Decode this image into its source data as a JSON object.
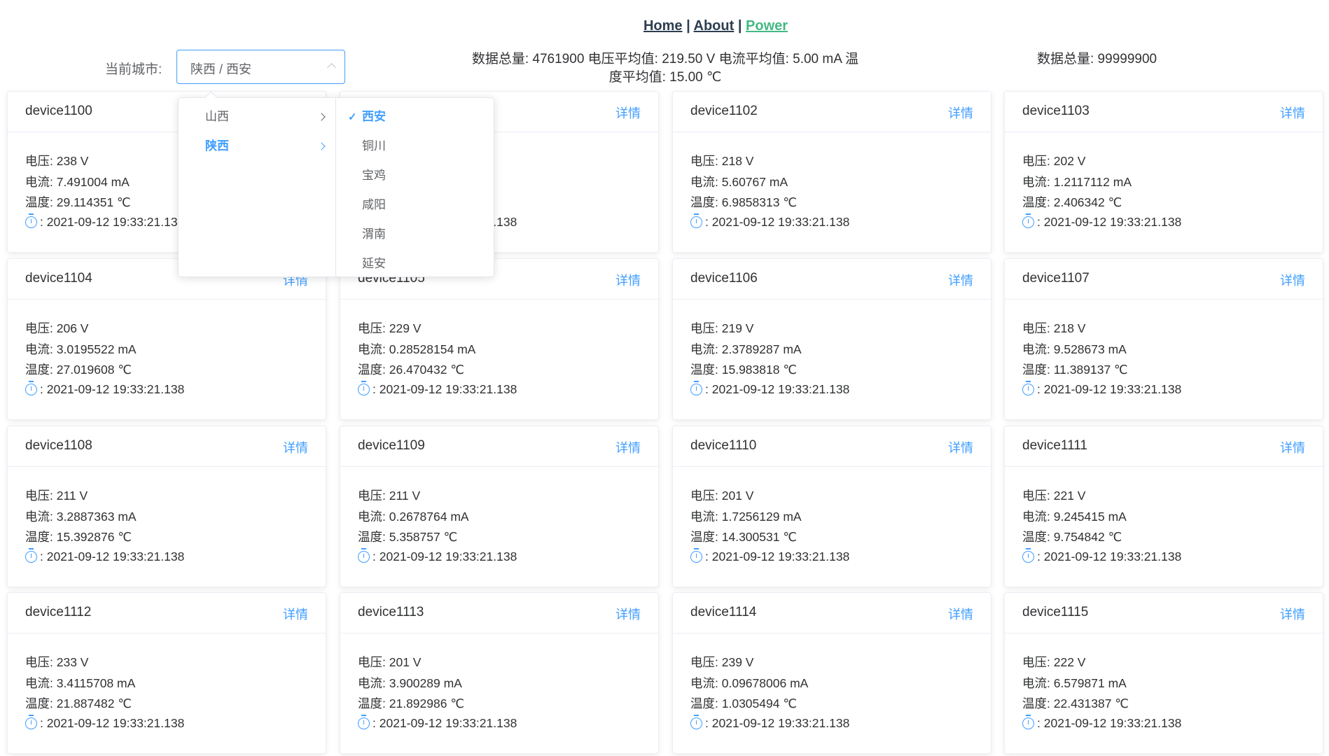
{
  "nav": {
    "home": "Home",
    "about": "About",
    "power": "Power",
    "sep": "|"
  },
  "city": {
    "label": "当前城市:",
    "value": "陕西 / 西安"
  },
  "stats": {
    "line1": "数据总量: 4761900 电压平均值: 219.50 V 电流平均值: 5.00 mA 温",
    "line2": "度平均值: 15.00 ℃",
    "total2": "数据总量: 99999900"
  },
  "cascader": {
    "provinces": [
      {
        "label": "山西",
        "selected": false
      },
      {
        "label": "陕西",
        "selected": true
      }
    ],
    "cities": [
      {
        "label": "西安",
        "selected": true
      },
      {
        "label": "铜川"
      },
      {
        "label": "宝鸡"
      },
      {
        "label": "咸阳"
      },
      {
        "label": "渭南"
      },
      {
        "label": "延安"
      }
    ]
  },
  "labels": {
    "voltage": "电压:",
    "current": "电流:",
    "temp": "温度:",
    "time_sep": ":",
    "detail": "详情"
  },
  "colors": {
    "accent": "#409eff",
    "power_link": "#42b983"
  },
  "devices": [
    {
      "name": "device1100",
      "voltage": "238 V",
      "current": "7.491004 mA",
      "temp": "29.114351 ℃",
      "time": "2021-09-12 19:33:21.138"
    },
    {
      "name": "",
      "voltage": "",
      "current": "",
      "temp": "",
      "time": "2021-09-12 19:33:21.138"
    },
    {
      "name": "device1102",
      "voltage": "218 V",
      "current": "5.60767 mA",
      "temp": "6.9858313 ℃",
      "time": "2021-09-12 19:33:21.138"
    },
    {
      "name": "device1103",
      "voltage": "202 V",
      "current": "1.2117112 mA",
      "temp": "2.406342 ℃",
      "time": "2021-09-12 19:33:21.138"
    },
    {
      "name": "device1104",
      "voltage": "206 V",
      "current": "3.0195522 mA",
      "temp": "27.019608 ℃",
      "time": "2021-09-12 19:33:21.138"
    },
    {
      "name": "device1105",
      "voltage": "229 V",
      "current": "0.28528154 mA",
      "temp": "26.470432 ℃",
      "time": "2021-09-12 19:33:21.138"
    },
    {
      "name": "device1106",
      "voltage": "219 V",
      "current": "2.3789287 mA",
      "temp": "15.983818 ℃",
      "time": "2021-09-12 19:33:21.138"
    },
    {
      "name": "device1107",
      "voltage": "218 V",
      "current": "9.528673 mA",
      "temp": "11.389137 ℃",
      "time": "2021-09-12 19:33:21.138"
    },
    {
      "name": "device1108",
      "voltage": "211 V",
      "current": "3.2887363 mA",
      "temp": "15.392876 ℃",
      "time": "2021-09-12 19:33:21.138"
    },
    {
      "name": "device1109",
      "voltage": "211 V",
      "current": "0.2678764 mA",
      "temp": "5.358757 ℃",
      "time": "2021-09-12 19:33:21.138"
    },
    {
      "name": "device1110",
      "voltage": "201 V",
      "current": "1.7256129 mA",
      "temp": "14.300531 ℃",
      "time": "2021-09-12 19:33:21.138"
    },
    {
      "name": "device1111",
      "voltage": "221 V",
      "current": "9.245415 mA",
      "temp": "9.754842 ℃",
      "time": "2021-09-12 19:33:21.138"
    },
    {
      "name": "device1112",
      "voltage": "233 V",
      "current": "3.4115708 mA",
      "temp": "21.887482 ℃",
      "time": "2021-09-12 19:33:21.138"
    },
    {
      "name": "device1113",
      "voltage": "201 V",
      "current": "3.900289 mA",
      "temp": "21.892986 ℃",
      "time": "2021-09-12 19:33:21.138"
    },
    {
      "name": "device1114",
      "voltage": "239 V",
      "current": "0.09678006 mA",
      "temp": "1.0305494 ℃",
      "time": "2021-09-12 19:33:21.138"
    },
    {
      "name": "device1115",
      "voltage": "222 V",
      "current": "6.579871 mA",
      "temp": "22.431387 ℃",
      "time": "2021-09-12 19:33:21.138"
    }
  ]
}
